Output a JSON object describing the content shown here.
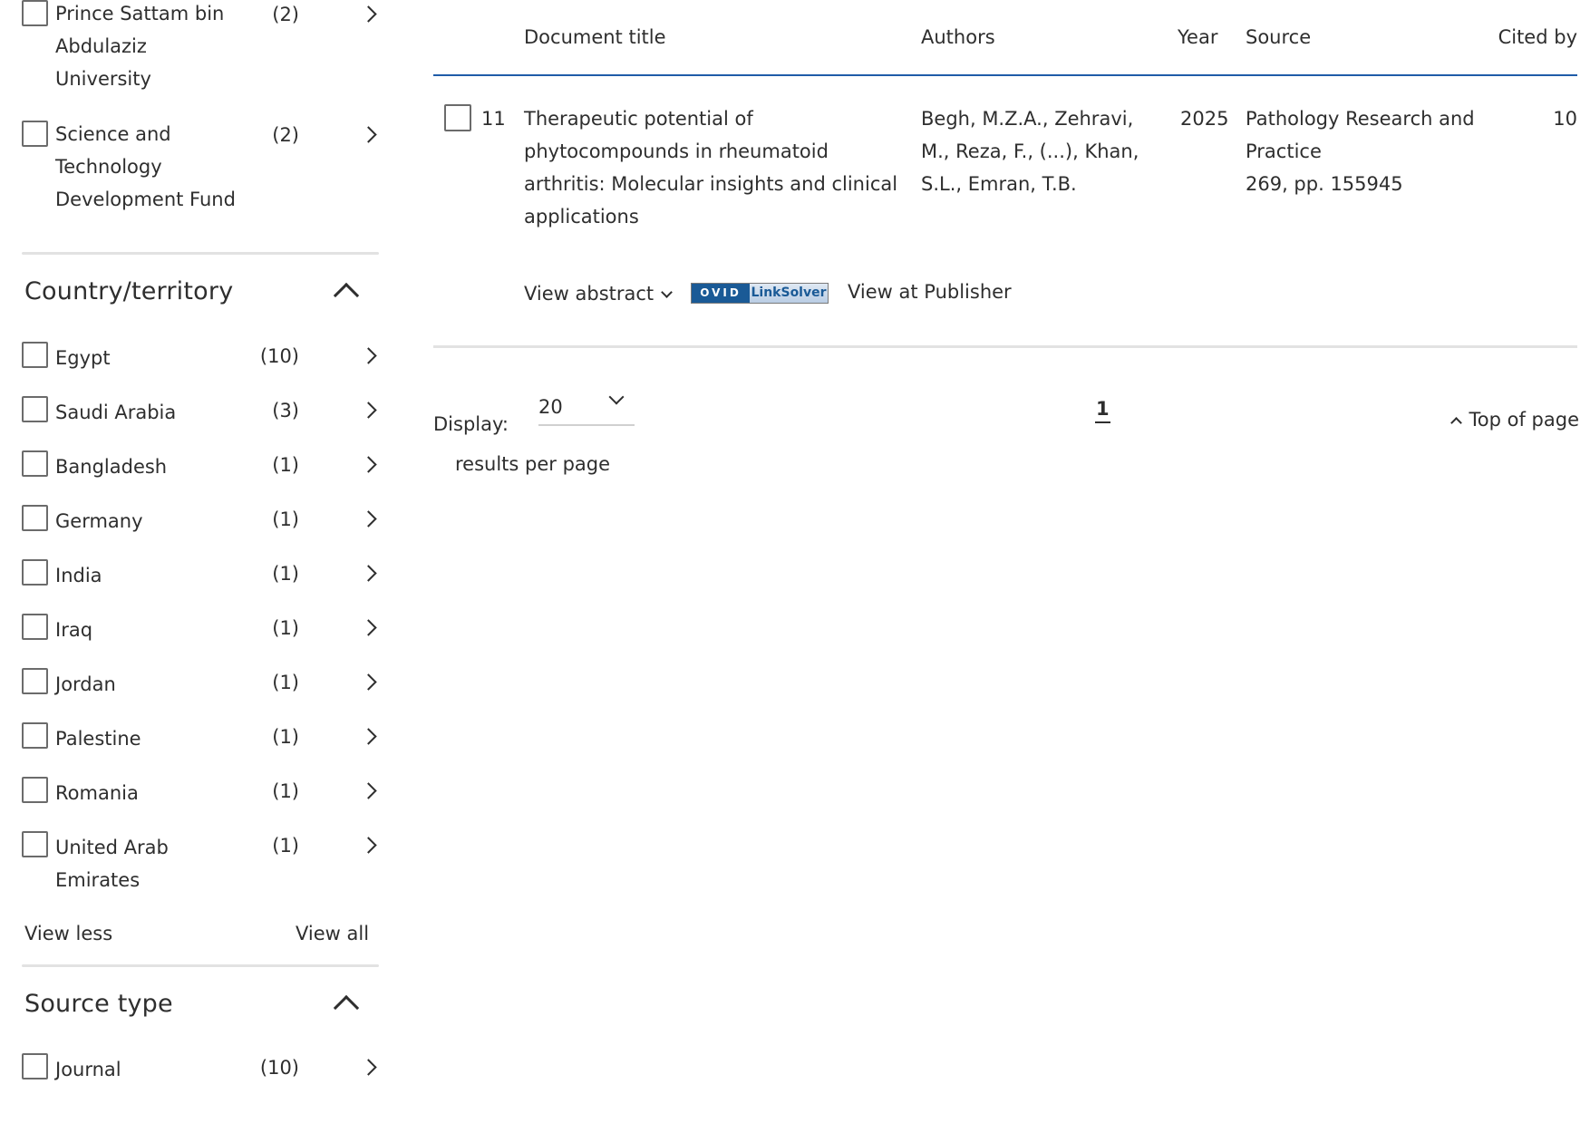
{
  "affiliation_items": [
    {
      "label": "Prince Sattam bin Abdulaziz University",
      "count": "(2)"
    },
    {
      "label": "Science and Technology Development Fund",
      "count": "(2)"
    }
  ],
  "country_section": {
    "title": "Country/territory",
    "items": [
      {
        "label": "Egypt",
        "count": "(10)"
      },
      {
        "label": "Saudi Arabia",
        "count": "(3)"
      },
      {
        "label": "Bangladesh",
        "count": "(1)"
      },
      {
        "label": "Germany",
        "count": "(1)"
      },
      {
        "label": "India",
        "count": "(1)"
      },
      {
        "label": "Iraq",
        "count": "(1)"
      },
      {
        "label": "Jordan",
        "count": "(1)"
      },
      {
        "label": "Palestine",
        "count": "(1)"
      },
      {
        "label": "Romania",
        "count": "(1)"
      },
      {
        "label": "United Arab Emirates",
        "count": "(1)"
      }
    ],
    "view_less": "View less",
    "view_all": "View all"
  },
  "source_type_section": {
    "title": "Source type",
    "items": [
      {
        "label": "Journal",
        "count": "(10)"
      }
    ]
  },
  "table": {
    "headers": {
      "title": "Document title",
      "authors": "Authors",
      "year": "Year",
      "source": "Source",
      "cited_by": "Cited by"
    },
    "row": {
      "number": "11",
      "title": "Therapeutic potential of phytocompounds in rheumatoid arthritis: Molecular insights and clinical applications",
      "authors": "Begh, M.Z.A., Zehravi, M., Reza, F., (...), Khan, S.L., Emran, T.B.",
      "year": "2025",
      "source_name": "Pathology Research and Practice",
      "source_detail": "269, pp. 155945",
      "cited_by": "10",
      "view_abstract": "View abstract",
      "linksolver_left": "OVID",
      "linksolver_right": "LinkSolver",
      "view_publisher": "View at Publisher"
    }
  },
  "pagination": {
    "display_label": "Display:",
    "per_page_value": "20",
    "per_page_suffix": "results per page",
    "current_page": "1",
    "top_of_page": "Top of page"
  }
}
